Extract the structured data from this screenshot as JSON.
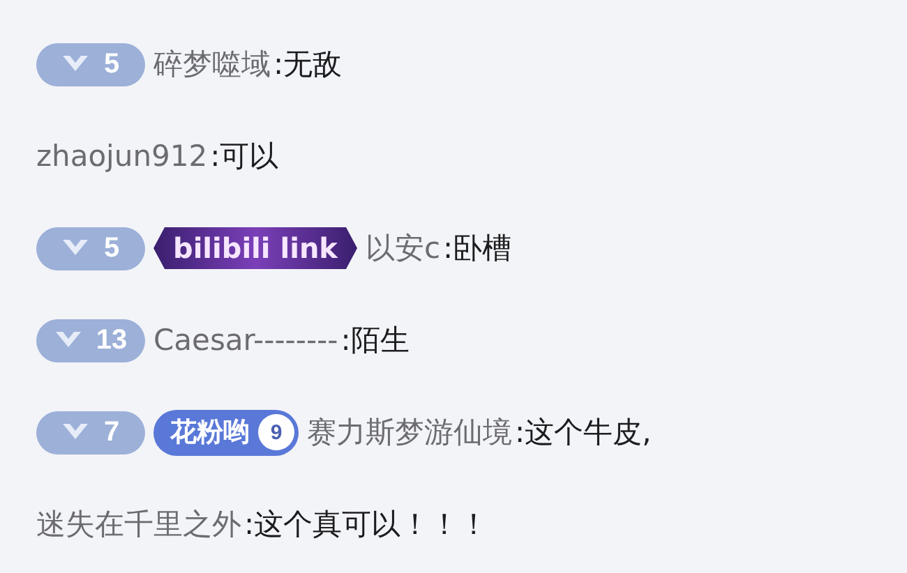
{
  "messages": [
    {
      "level": "5",
      "user": "碎梦噬域",
      "text": ":无敌"
    },
    {
      "user": "zhaojun912",
      "text": ":可以"
    },
    {
      "level": "5",
      "medals": [
        {
          "kind": "logo",
          "label": "bilibili link"
        }
      ],
      "user": "以安c",
      "text": ":卧槽"
    },
    {
      "level": "13",
      "user": "Caesar--------",
      "text": ":陌生"
    },
    {
      "level": "7",
      "medals": [
        {
          "kind": "fan",
          "label": "花粉哟",
          "rank": "9"
        }
      ],
      "user": "赛力斯梦游仙境",
      "text": ":这个牛皮,"
    },
    {
      "user": "迷失在千里之外",
      "text": ":这个真可以！！！"
    }
  ]
}
